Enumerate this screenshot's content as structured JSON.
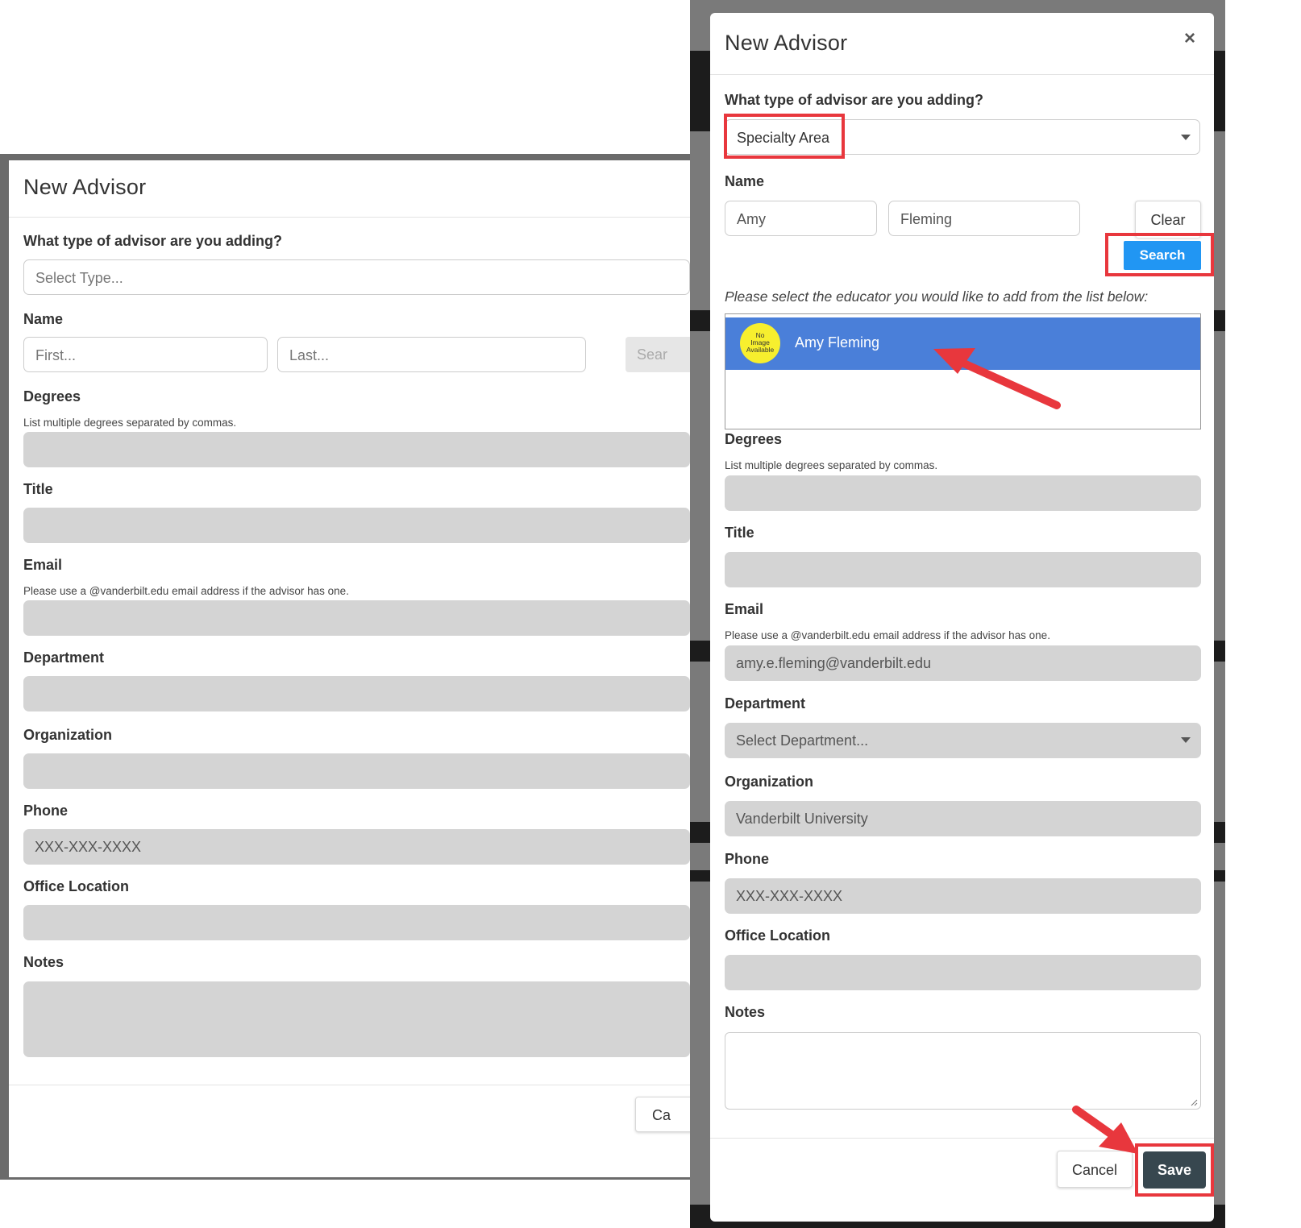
{
  "left_modal": {
    "title": "New Advisor",
    "type_question": "What type of advisor are you adding?",
    "type_placeholder": "Select Type...",
    "name_label": "Name",
    "first_placeholder": "First...",
    "last_placeholder": "Last...",
    "search_partial": "Sear",
    "degrees_label": "Degrees",
    "degrees_help": "List multiple degrees separated by commas.",
    "title_label": "Title",
    "email_label": "Email",
    "email_help": "Please use a @vanderbilt.edu email address if the advisor has one.",
    "department_label": "Department",
    "organization_label": "Organization",
    "phone_label": "Phone",
    "phone_placeholder": "XXX-XXX-XXXX",
    "office_label": "Office Location",
    "notes_label": "Notes",
    "cancel_partial": "Ca"
  },
  "right_modal": {
    "title": "New Advisor",
    "close_symbol": "×",
    "type_question": "What type of advisor are you adding?",
    "type_value": "Specialty Area",
    "name_label": "Name",
    "first_value": "Amy",
    "last_value": "Fleming",
    "clear_label": "Clear",
    "search_label": "Search",
    "select_prompt": "Please select the educator you would like to add from the list below:",
    "result": {
      "name": "Amy Fleming",
      "avatar_text": [
        "No",
        "Image",
        "Available"
      ]
    },
    "degrees_label": "Degrees",
    "degrees_help": "List multiple degrees separated by commas.",
    "title_label": "Title",
    "email_label": "Email",
    "email_help": "Please use a @vanderbilt.edu email address if the advisor has one.",
    "email_value": "amy.e.fleming@vanderbilt.edu",
    "department_label": "Department",
    "department_placeholder": "Select Department...",
    "organization_label": "Organization",
    "organization_value": "Vanderbilt University",
    "phone_label": "Phone",
    "phone_placeholder": "XXX-XXX-XXXX",
    "office_label": "Office Location",
    "notes_label": "Notes",
    "cancel_label": "Cancel",
    "save_label": "Save"
  },
  "colors": {
    "highlight_red": "#e8373d",
    "search_blue": "#2196f3",
    "selected_row_blue": "#4a7fd9",
    "save_dark": "#37474f",
    "field_gray": "#d4d4d4",
    "avatar_yellow": "#f7ef2e"
  },
  "icons": [
    "close-icon",
    "chevron-down-icon",
    "arrow-annotation-icon",
    "resize-grip-icon"
  ]
}
